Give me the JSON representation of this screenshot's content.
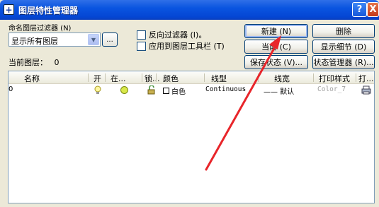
{
  "window": {
    "title": "图层特性管理器",
    "help": "?",
    "close": "X"
  },
  "filter": {
    "label": "命名图层过滤器 (N)",
    "selected": "显示所有图层",
    "dots": "...",
    "invert_label": "反向过滤器 (I)。",
    "apply_label": "应用到图层工具栏 (T)"
  },
  "buttons": {
    "new": "新建 (N)",
    "delete": "删除",
    "current": "当前 (C)",
    "show_details": "显示细节 (D)",
    "save_state": "保存状态 (V)...",
    "state_manager": "状态管理器 (R)..."
  },
  "current_layer": {
    "label": "当前图层：",
    "value": "0"
  },
  "table": {
    "headers": [
      "名称",
      "开",
      "在...",
      "锁...",
      "颜色",
      "线型",
      "线宽",
      "打印样式",
      "打..."
    ],
    "rows": [
      {
        "name": "0",
        "color": "白色",
        "linetype": "Continuous",
        "lineweight": "—— 默认",
        "plotstyle": "Color_7"
      }
    ]
  },
  "colors": {
    "arrow": "#e8252a",
    "title_bar": "#0a55e0"
  }
}
